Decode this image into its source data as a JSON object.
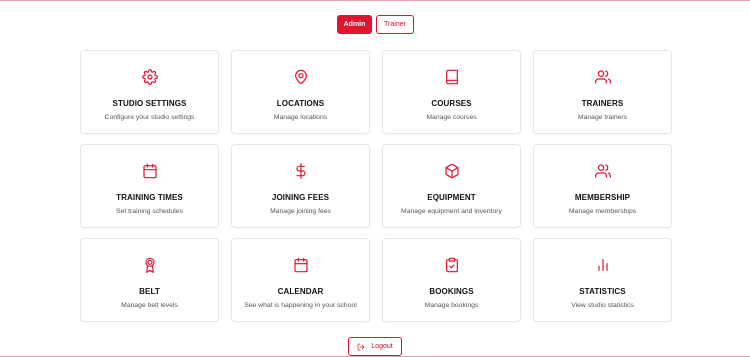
{
  "roles": {
    "admin": "Admin",
    "trainer": "Trainer",
    "active": "Admin"
  },
  "accent": "#e3122f",
  "cards": [
    {
      "icon": "gear-icon",
      "title": "STUDIO SETTINGS",
      "desc": "Configure your studio settings"
    },
    {
      "icon": "map-pin-icon",
      "title": "LOCATIONS",
      "desc": "Manage locations"
    },
    {
      "icon": "book-icon",
      "title": "COURSES",
      "desc": "Manage courses"
    },
    {
      "icon": "users-icon",
      "title": "TRAINERS",
      "desc": "Manage trainers"
    },
    {
      "icon": "calendar-icon",
      "title": "TRAINING TIMES",
      "desc": "Set training schedules"
    },
    {
      "icon": "dollar-icon",
      "title": "JOINING FEES",
      "desc": "Manage joining fees"
    },
    {
      "icon": "box-icon",
      "title": "EQUIPMENT",
      "desc": "Manage equipment and inventory"
    },
    {
      "icon": "users-icon",
      "title": "MEMBERSHIP",
      "desc": "Manage memberships"
    },
    {
      "icon": "award-icon",
      "title": "BELT",
      "desc": "Manage belt levels"
    },
    {
      "icon": "calendar-icon",
      "title": "CALENDAR",
      "desc": "See what is happening in your school"
    },
    {
      "icon": "clipboard-check-icon",
      "title": "BOOKINGS",
      "desc": "Manage bookings"
    },
    {
      "icon": "bar-chart-icon",
      "title": "STATISTICS",
      "desc": "View studio statistics"
    }
  ],
  "logout": {
    "label": "Logout",
    "icon": "logout-icon"
  }
}
